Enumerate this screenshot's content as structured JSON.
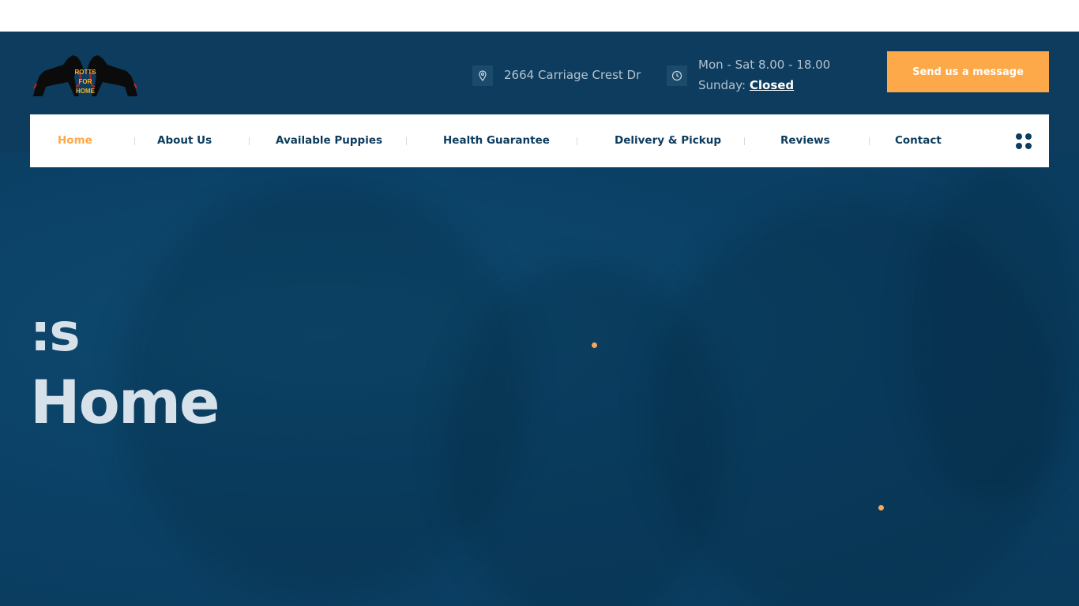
{
  "header": {
    "logo_text": "ROTTS FOR HOME",
    "address": "2664 Carriage Crest Dr",
    "hours_weekday": "Mon - Sat 8.00 - 18.00",
    "hours_sunday_label": "Sunday:",
    "hours_sunday_value": "Closed",
    "cta_label": "Send us a message"
  },
  "nav": {
    "items": [
      {
        "label": "Home",
        "active": true
      },
      {
        "label": "About Us"
      },
      {
        "label": "Available Puppies"
      },
      {
        "label": "Health Guarantee"
      },
      {
        "label": "Delivery & Pickup"
      },
      {
        "label": "Reviews"
      },
      {
        "label": "Contact"
      }
    ]
  },
  "hero": {
    "line1": ":s",
    "line2": "Home"
  },
  "icons": {
    "address": "map-pin-icon",
    "hours": "clock-icon",
    "menu": "grid-menu-icon"
  },
  "colors": {
    "brand_navy": "#0d3c5e",
    "accent_orange": "#fda94a",
    "hero_bg": "#0b4166"
  }
}
